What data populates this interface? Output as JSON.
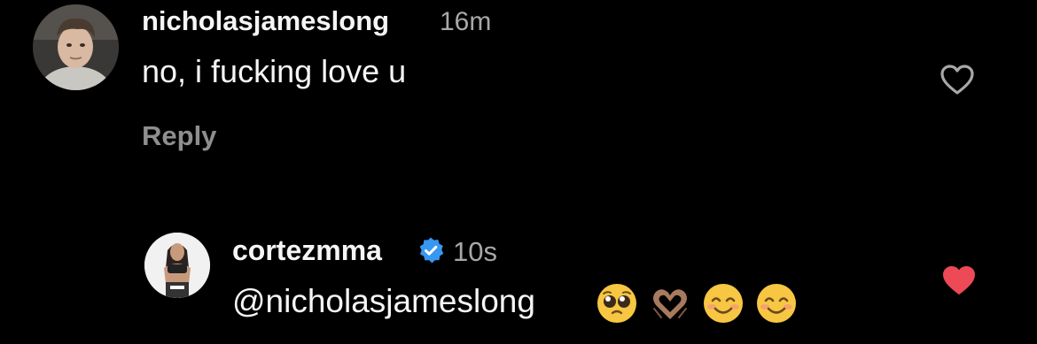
{
  "colors": {
    "background": "#000000",
    "primary_text": "#f5f5f5",
    "secondary_text": "#a8a8a8",
    "reply_text": "#8e8e8e",
    "liked_heart": "#ed4956",
    "verified_badge": "#3897f0"
  },
  "comments": [
    {
      "username": "nicholasjameslong",
      "time": "16m",
      "text": "no, i fucking love u",
      "reply_label": "Reply",
      "liked": false,
      "like_icon": "heart-outline-icon"
    },
    {
      "username": "cortezmma",
      "verified": true,
      "verified_icon": "verified-badge-icon",
      "time": "10s",
      "text": "@nicholasjameslong",
      "emojis": [
        "pleading-face-emoji",
        "heart-hands-emoji",
        "smiling-face-emoji",
        "smiling-face-emoji"
      ],
      "liked": true,
      "like_icon": "heart-filled-icon"
    }
  ]
}
